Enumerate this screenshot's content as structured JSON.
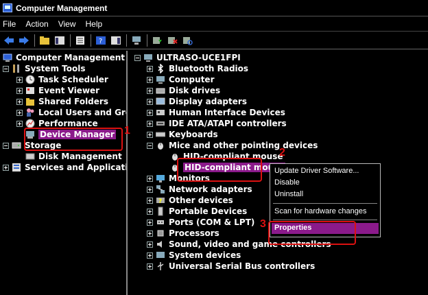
{
  "window": {
    "title": "Computer Management"
  },
  "menu": [
    "File",
    "Action",
    "View",
    "Help"
  ],
  "left_tree": [
    {
      "label": "Computer Management (Loca",
      "expander": "none",
      "icon": "computer-management-icon",
      "indent": 0
    },
    {
      "label": "System Tools",
      "expander": "minus",
      "icon": "tools-icon",
      "indent": 1
    },
    {
      "label": "Task Scheduler",
      "expander": "plus",
      "icon": "clock-icon",
      "indent": 2
    },
    {
      "label": "Event Viewer",
      "expander": "plus",
      "icon": "event-viewer-icon",
      "indent": 2
    },
    {
      "label": "Shared Folders",
      "expander": "plus",
      "icon": "folder-icon",
      "indent": 2
    },
    {
      "label": "Local Users and Grou",
      "expander": "plus",
      "icon": "users-icon",
      "indent": 2
    },
    {
      "label": "Performance",
      "expander": "plus",
      "icon": "performance-icon",
      "indent": 2
    },
    {
      "label": "Device Manager",
      "expander": "none",
      "icon": "device-manager-icon",
      "indent": 2,
      "selected": true
    },
    {
      "label": "Storage",
      "expander": "minus",
      "icon": "storage-icon",
      "indent": 1
    },
    {
      "label": "Disk Management",
      "expander": "none",
      "icon": "disk-icon",
      "indent": 2
    },
    {
      "label": "Services and Applications",
      "expander": "plus",
      "icon": "services-icon",
      "indent": 1
    }
  ],
  "right_tree": {
    "root": "ULTRASO-UCE1FPI",
    "items": [
      {
        "label": "Bluetooth Radios",
        "expander": "plus",
        "icon": "bluetooth-icon"
      },
      {
        "label": "Computer",
        "expander": "plus",
        "icon": "computer-icon"
      },
      {
        "label": "Disk drives",
        "expander": "plus",
        "icon": "disk-drive-icon"
      },
      {
        "label": "Display adapters",
        "expander": "plus",
        "icon": "display-adapter-icon"
      },
      {
        "label": "Human Interface Devices",
        "expander": "plus",
        "icon": "hid-icon"
      },
      {
        "label": "IDE ATA/ATAPI controllers",
        "expander": "plus",
        "icon": "ide-icon"
      },
      {
        "label": "Keyboards",
        "expander": "plus",
        "icon": "keyboard-icon"
      },
      {
        "label": "Mice and other pointing devices",
        "expander": "minus",
        "icon": "mouse-icon"
      },
      {
        "label": "HID-compliant mouse",
        "expander": "none",
        "icon": "mouse-icon",
        "child": true
      },
      {
        "label": "HID-compliant mouse",
        "expander": "none",
        "icon": "mouse-icon",
        "child": true,
        "selected": true
      },
      {
        "label": "Monitors",
        "expander": "plus",
        "icon": "monitor-icon"
      },
      {
        "label": "Network adapters",
        "expander": "plus",
        "icon": "network-icon"
      },
      {
        "label": "Other devices",
        "expander": "plus",
        "icon": "other-devices-icon"
      },
      {
        "label": "Portable Devices",
        "expander": "plus",
        "icon": "portable-icon"
      },
      {
        "label": "Ports (COM & LPT)",
        "expander": "plus",
        "icon": "port-icon"
      },
      {
        "label": "Processors",
        "expander": "plus",
        "icon": "processor-icon"
      },
      {
        "label": "Sound, video and game controllers",
        "expander": "plus",
        "icon": "sound-icon"
      },
      {
        "label": "System devices",
        "expander": "plus",
        "icon": "system-devices-icon"
      },
      {
        "label": "Universal Serial Bus controllers",
        "expander": "plus",
        "icon": "usb-icon"
      }
    ]
  },
  "context_menu": {
    "items": [
      "Update Driver Software...",
      "Disable",
      "Uninstall",
      "Scan for hardware changes",
      "Properties"
    ],
    "highlighted": "Properties"
  },
  "annotations": [
    "1",
    "2",
    "3"
  ],
  "colors": {
    "selection": "#8b1a8b",
    "annotation": "#dd1111",
    "background": "#000000"
  }
}
